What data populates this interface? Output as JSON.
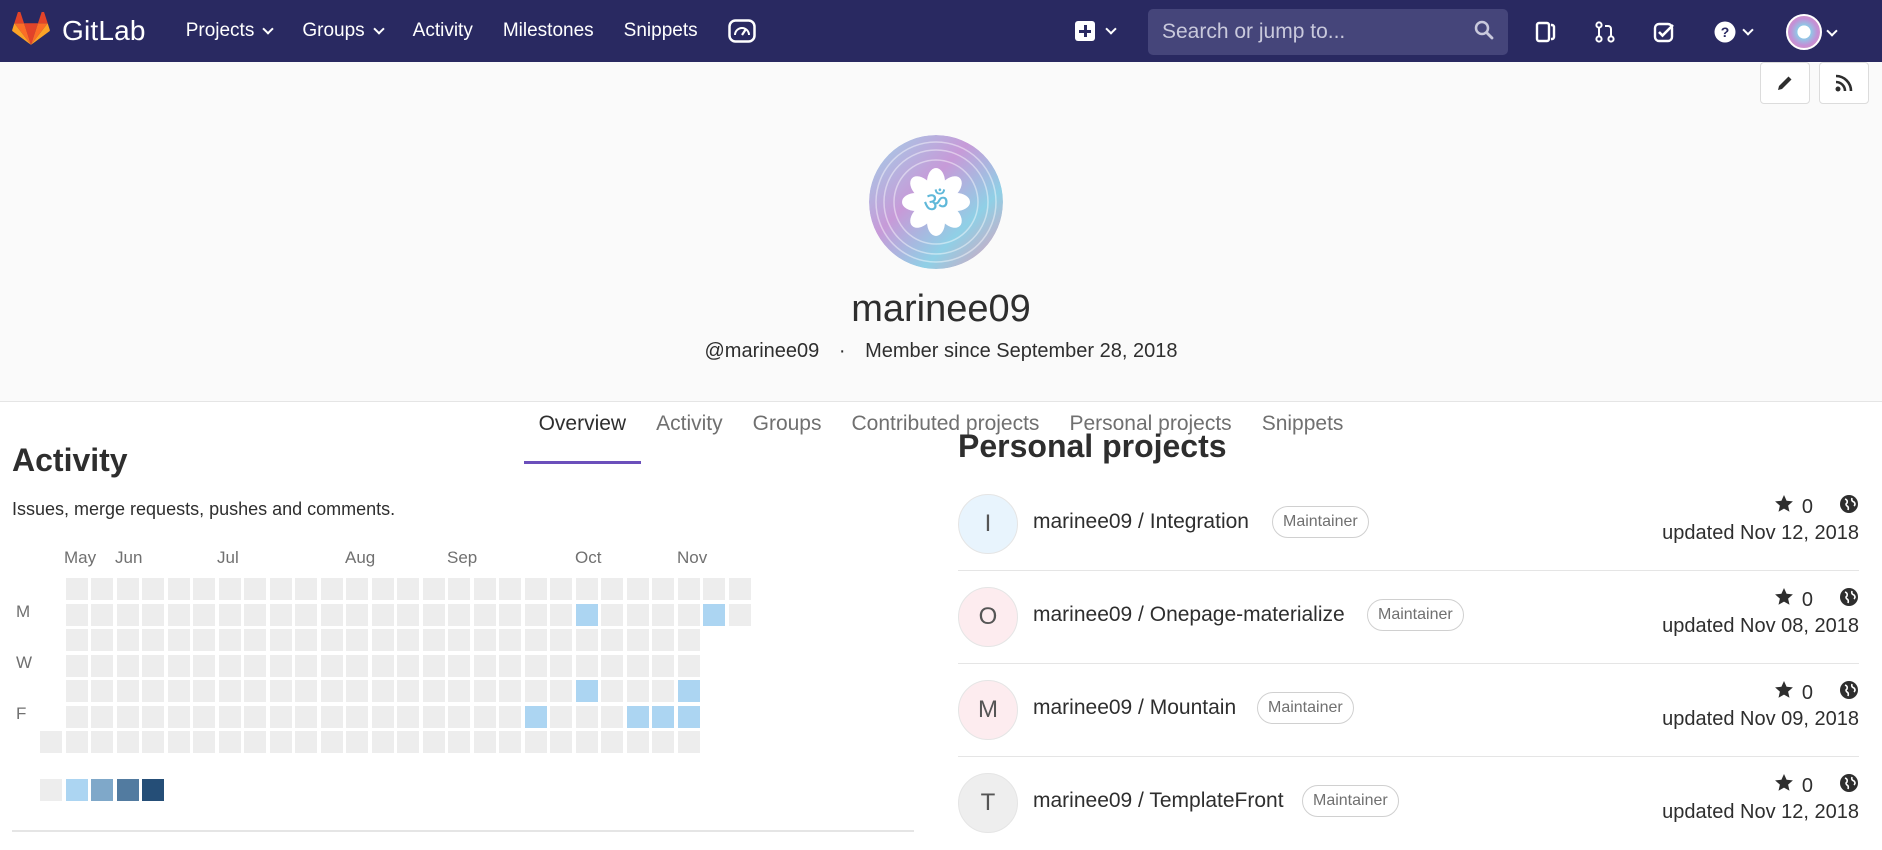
{
  "navbar": {
    "brand": "GitLab",
    "links": [
      {
        "label": "Projects",
        "dropdown": true
      },
      {
        "label": "Groups",
        "dropdown": true
      },
      {
        "label": "Activity",
        "dropdown": false
      },
      {
        "label": "Milestones",
        "dropdown": false
      },
      {
        "label": "Snippets",
        "dropdown": false
      }
    ],
    "search_placeholder": "Search or jump to..."
  },
  "profile": {
    "name": "marinee09",
    "handle": "@marinee09",
    "separator": "·",
    "member_since": "Member since September 28, 2018"
  },
  "tabs": [
    {
      "label": "Overview",
      "active": true
    },
    {
      "label": "Activity",
      "active": false
    },
    {
      "label": "Groups",
      "active": false
    },
    {
      "label": "Contributed projects",
      "active": false
    },
    {
      "label": "Personal projects",
      "active": false
    },
    {
      "label": "Snippets",
      "active": false
    }
  ],
  "activity": {
    "title": "Activity",
    "subtitle": "Issues, merge requests, pushes and comments.",
    "months": [
      "May",
      "Jun",
      "Jul",
      "Aug",
      "Sep",
      "Oct",
      "Nov"
    ],
    "day_labels": [
      "M",
      "W",
      "F"
    ],
    "legend_colors": [
      "#ededed",
      "#acd5f2",
      "#7fa8c9",
      "#527ba0",
      "#254e77"
    ],
    "contributions": [
      {
        "week": 21,
        "day": 1,
        "level": 1
      },
      {
        "week": 26,
        "day": 1,
        "level": 1
      },
      {
        "week": 21,
        "day": 4,
        "level": 1
      },
      {
        "week": 25,
        "day": 4,
        "level": 1
      },
      {
        "week": 19,
        "day": 5,
        "level": 1
      },
      {
        "week": 23,
        "day": 5,
        "level": 1
      },
      {
        "week": 24,
        "day": 5,
        "level": 1
      },
      {
        "week": 25,
        "day": 5,
        "level": 1
      }
    ]
  },
  "projects": {
    "title": "Personal projects",
    "items": [
      {
        "initial": "I",
        "avatar_bg": "#e8f4fd",
        "name": "marinee09 / Integration",
        "role": "Maintainer",
        "stars": "0",
        "updated": "updated Nov 12, 2018"
      },
      {
        "initial": "O",
        "avatar_bg": "#fdecef",
        "name": "marinee09 / Onepage-materialize",
        "role": "Maintainer",
        "stars": "0",
        "updated": "updated Nov 08, 2018"
      },
      {
        "initial": "M",
        "avatar_bg": "#fdecef",
        "name": "marinee09 / Mountain",
        "role": "Maintainer",
        "stars": "0",
        "updated": "updated Nov 09, 2018"
      },
      {
        "initial": "T",
        "avatar_bg": "#eeeeee",
        "name": "marinee09 / TemplateFront",
        "role": "Maintainer",
        "stars": "0",
        "updated": "updated Nov 12, 2018"
      }
    ]
  }
}
